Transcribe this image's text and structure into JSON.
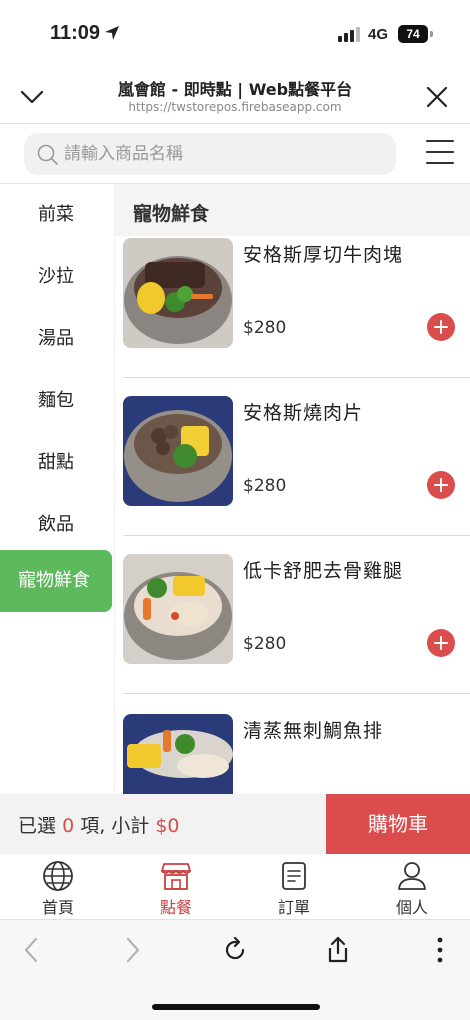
{
  "status": {
    "time": "11:09",
    "network": "4G",
    "battery": "74"
  },
  "browser": {
    "title": "嵐會館 - 即時點 | Web點餐平台",
    "url": "https://twstorepos.firebaseapp.com"
  },
  "search": {
    "placeholder": "請輸入商品名稱"
  },
  "categories": [
    {
      "label": "前菜"
    },
    {
      "label": "沙拉"
    },
    {
      "label": "湯品"
    },
    {
      "label": "麵包"
    },
    {
      "label": "甜點"
    },
    {
      "label": "飲品"
    },
    {
      "label": "寵物鮮食",
      "active": true
    }
  ],
  "section_title": "寵物鮮食",
  "items": [
    {
      "name": "安格斯厚切牛肉塊",
      "price": "$280"
    },
    {
      "name": "安格斯燒肉片",
      "price": "$280"
    },
    {
      "name": "低卡舒肥去骨雞腿",
      "price": "$280"
    },
    {
      "name": "清蒸無刺鯛魚排",
      "price": ""
    }
  ],
  "cart": {
    "prefix": "已選",
    "count": "0",
    "middle": "項, 小計",
    "total": "$0",
    "button_label": "購物車"
  },
  "tabs": [
    {
      "label": "首頁",
      "icon": "globe-icon"
    },
    {
      "label": "點餐",
      "icon": "store-icon",
      "active": true
    },
    {
      "label": "訂單",
      "icon": "receipt-icon"
    },
    {
      "label": "個人",
      "icon": "person-icon"
    }
  ],
  "colors": {
    "accent_red": "#db4d4d",
    "category_green": "#5cba5c"
  }
}
